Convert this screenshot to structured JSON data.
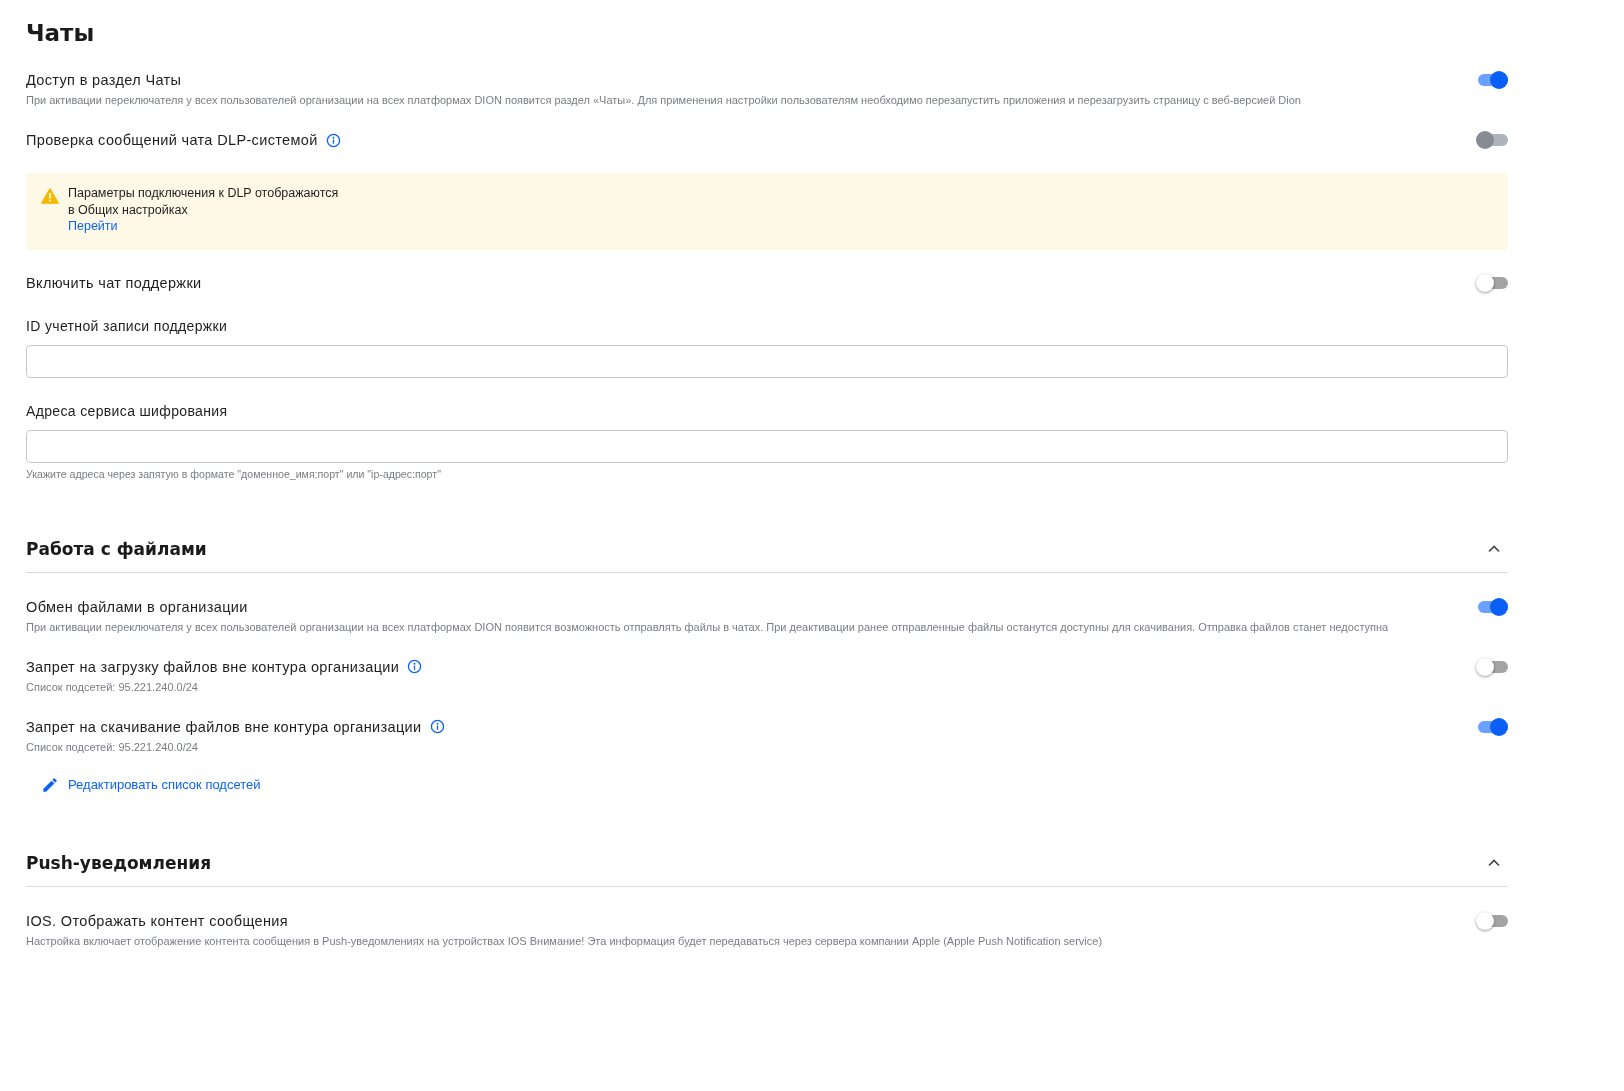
{
  "title": "Чаты",
  "items": [
    {
      "kind": "toggle",
      "label": "Доступ в раздел Чаты",
      "description": "При активации переключателя у всех пользователей организации на всех платформах DION появится раздел «Чаты». Для применения настройки пользователям необходимо перезапустить приложения и перезагрузить страницу с веб-версией Dion",
      "info": false,
      "on": true,
      "disabled": false
    },
    {
      "kind": "toggle",
      "label": "Проверка сообщений чата DLP-системой",
      "info": true,
      "on": false,
      "disabled": true
    },
    {
      "kind": "note",
      "lines": [
        "Параметры подключения к DLP отображаются",
        "в Общих настройках"
      ],
      "link": "Перейти"
    },
    {
      "kind": "toggle",
      "label": "Включить чат поддержки",
      "info": false,
      "on": false,
      "disabled": false
    },
    {
      "kind": "field",
      "label": "ID учетной записи поддержки"
    },
    {
      "kind": "field",
      "label": "Адреса сервиса шифрования",
      "hint": "Укажите адреса через запятую в формате \"доменное_имя:порт\" или \"ip-адрес:порт\""
    }
  ],
  "sections": [
    {
      "title": "Работа с файлами",
      "expanded": true,
      "items": [
        {
          "kind": "toggle",
          "label": "Обмен файлами в организации",
          "description": "При активации переключателя у всех пользователей организации на всех платформах DION появится возможность отправлять файлы в чатах. При деактивации ранее отправленные файлы останутся доступны для скачивания. Отправка файлов станет недоступна",
          "info": false,
          "on": true,
          "disabled": false
        },
        {
          "kind": "toggle",
          "label": "Запрет на загрузку файлов вне контура организации",
          "subnets": "Список подсетей: 95.221.240.0/24",
          "info": true,
          "on": false,
          "disabled": false
        },
        {
          "kind": "toggle",
          "label": "Запрет на скачивание файлов вне контура организации",
          "subnets": "Список подсетей: 95.221.240.0/24",
          "info": true,
          "on": true,
          "disabled": false
        },
        {
          "kind": "edit-link",
          "label": "Редактировать список подсетей"
        }
      ]
    },
    {
      "title": "Push-уведомления",
      "expanded": true,
      "items": [
        {
          "kind": "toggle",
          "label": "IOS. Отображать контент сообщения",
          "description": "Настройка включает отображение контента сообщения в Push-уведомлениях на устройствах IOS Внимание! Эта информация будет передаваться через сервера компании Apple (Apple Push Notification service)",
          "info": false,
          "on": false,
          "disabled": false
        }
      ]
    }
  ]
}
